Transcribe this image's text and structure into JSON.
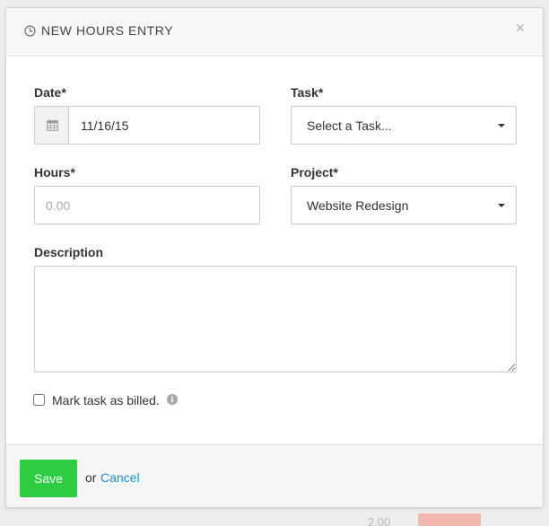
{
  "modal": {
    "title": "NEW HOURS ENTRY",
    "close_label": "×"
  },
  "form": {
    "date": {
      "label": "Date*",
      "value": "11/16/15"
    },
    "task": {
      "label": "Task*",
      "selected": "Select a Task..."
    },
    "hours": {
      "label": "Hours*",
      "placeholder": "0.00",
      "value": ""
    },
    "project": {
      "label": "Project*",
      "selected": "Website Redesign"
    },
    "description": {
      "label": "Description",
      "value": ""
    },
    "billed": {
      "label": "Mark task as billed.",
      "checked": false
    }
  },
  "footer": {
    "save_label": "Save",
    "or_text": "or",
    "cancel_label": "Cancel"
  },
  "background": {
    "amount": "2.00"
  },
  "colors": {
    "save_button": "#2ecc40",
    "cancel_link": "#1a8fd8",
    "header_background": "#f7f7f7",
    "footer_background": "#f5f5f5"
  },
  "icons": {
    "header": "clock-icon",
    "date_addon": "calendar-icon",
    "billed_info": "info-icon",
    "dropdown": "caret-down-icon"
  }
}
